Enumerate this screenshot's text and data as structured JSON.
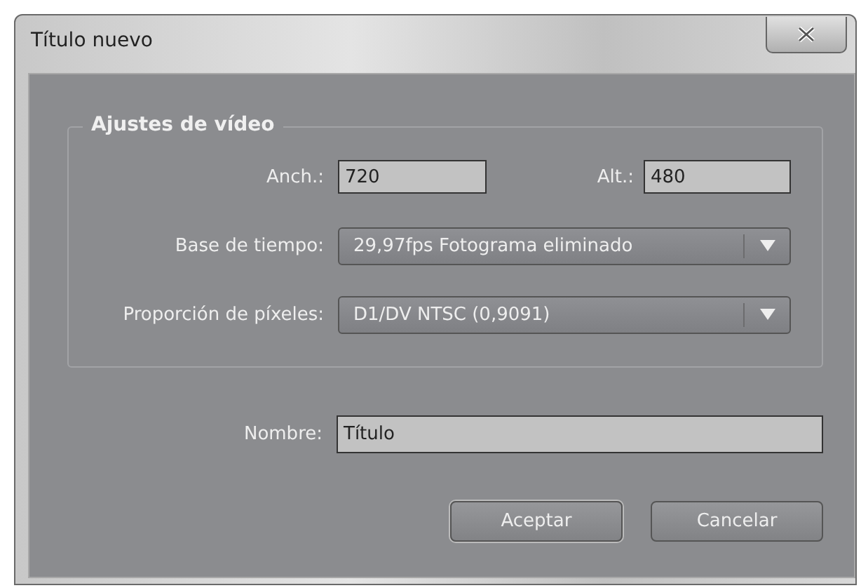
{
  "window": {
    "title": "Título nuevo"
  },
  "video_settings": {
    "title": "Ajustes de vídeo",
    "width": {
      "label": "Anch.:",
      "value": "720"
    },
    "height": {
      "label": "Alt.:",
      "value": "480"
    },
    "dropdowns": [
      {
        "label": "Base de tiempo:",
        "value": "29,97fps Fotograma eliminado"
      },
      {
        "label": "Proporción de píxeles:",
        "value": "D1/DV NTSC (0,9091)"
      }
    ]
  },
  "name": {
    "label": "Nombre:",
    "value": "Título"
  },
  "buttons": [
    "Aceptar",
    "Cancelar"
  ]
}
